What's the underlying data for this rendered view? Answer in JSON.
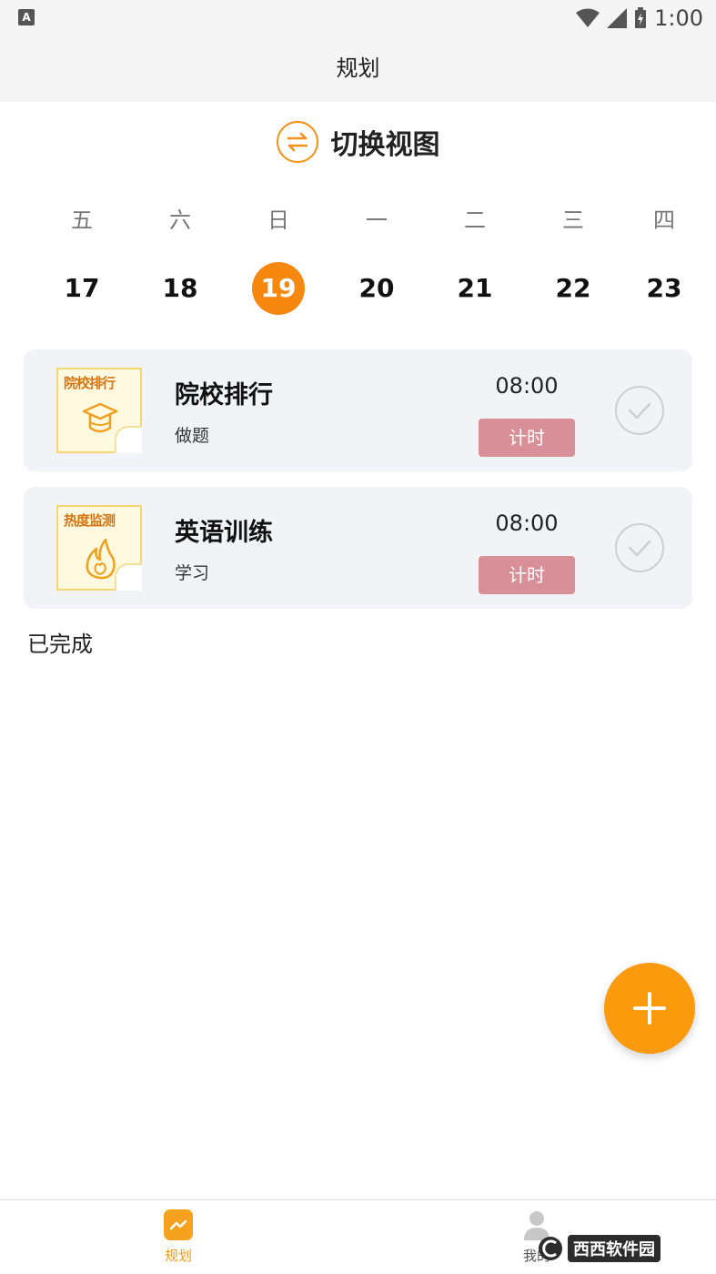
{
  "status_bar": {
    "badge": "A",
    "time": "1:00"
  },
  "header": {
    "title": "规划"
  },
  "view_switch": {
    "label": "切换视图",
    "icon": "swap-arrows-icon",
    "color": "#f2921d"
  },
  "week": [
    {
      "name": "五",
      "num": "17",
      "active": false
    },
    {
      "name": "六",
      "num": "18",
      "active": false
    },
    {
      "name": "日",
      "num": "19",
      "active": true
    },
    {
      "name": "一",
      "num": "20",
      "active": false
    },
    {
      "name": "二",
      "num": "21",
      "active": false
    },
    {
      "name": "三",
      "num": "22",
      "active": false
    },
    {
      "name": "四",
      "num": "23",
      "active": false
    }
  ],
  "tasks": [
    {
      "thumb_text": "院校排行",
      "thumb_icon": "graduation-cap-icon",
      "title": "院校排行",
      "subtitle": "做题",
      "time": "08:00",
      "timer_label": "计时"
    },
    {
      "thumb_text": "热度监测",
      "thumb_icon": "flame-icon",
      "title": "英语训练",
      "subtitle": "学习",
      "time": "08:00",
      "timer_label": "计时"
    }
  ],
  "completed_section": {
    "label": "已完成"
  },
  "fab": {
    "icon": "plus-icon",
    "color": "#fb9a0c"
  },
  "bottom_nav": [
    {
      "label": "规划",
      "icon": "plan-icon",
      "active": true
    },
    {
      "label": "我的",
      "icon": "person-icon",
      "active": false
    }
  ],
  "watermark": {
    "text": "西西软件园"
  },
  "colors": {
    "accent": "#f7880f",
    "timer_button": "#d98f97",
    "card_bg": "#f2f3f7"
  }
}
